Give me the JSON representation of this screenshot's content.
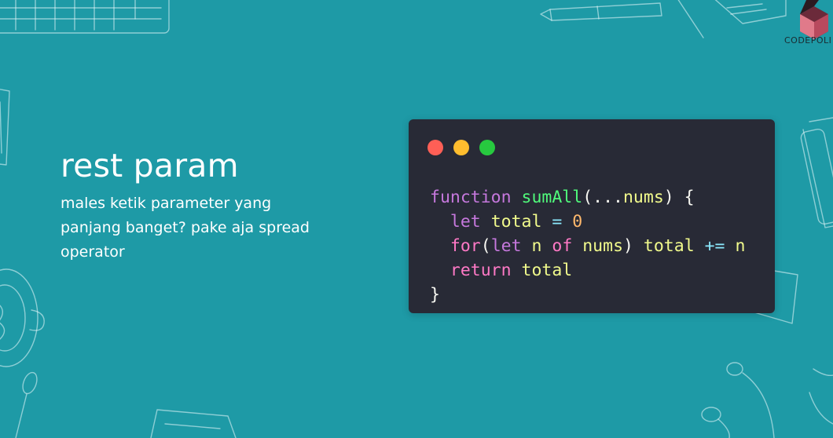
{
  "logo": {
    "text_part1": "CODE",
    "text_part2": "POLI"
  },
  "slide": {
    "title": "rest param",
    "subtitle": "males ketik parameter yang panjang banget? pake aja spread operator"
  },
  "code": {
    "line1": {
      "keyword": "function",
      "name": "sumAll",
      "open": "(",
      "spread": "...",
      "param": "nums",
      "close": ") {"
    },
    "line2": {
      "indent": "  ",
      "keyword": "let",
      "var": "total",
      "op": "=",
      "value": "0"
    },
    "line3": {
      "indent": "  ",
      "keyword": "for",
      "open": "(",
      "let": "let",
      "var": "n",
      "of": "of",
      "iter": "nums",
      "close": ")",
      "target": "total",
      "op": "+=",
      "operand": "n"
    },
    "line4": {
      "indent": "  ",
      "keyword": "return",
      "value": "total"
    },
    "line5": {
      "close": "}"
    }
  },
  "colors": {
    "background": "#1e9aa6",
    "code_background": "#282a36",
    "dot_red": "#ff5f56",
    "dot_yellow": "#ffbd2e",
    "dot_green": "#27c93f"
  }
}
